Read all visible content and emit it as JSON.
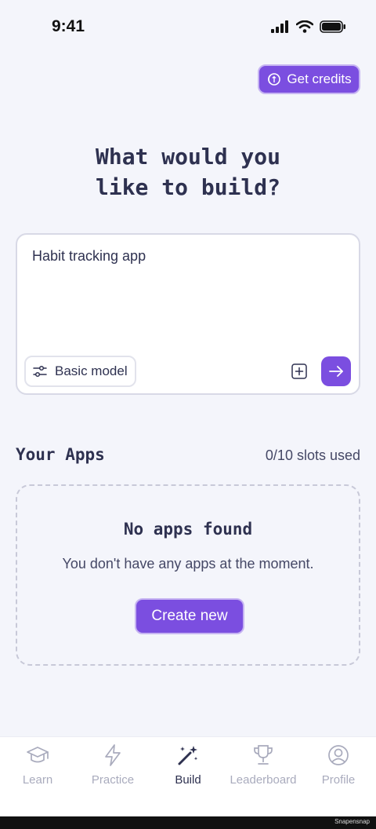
{
  "status_bar": {
    "time": "9:41"
  },
  "header": {
    "credits_label": "Get credits"
  },
  "headline": {
    "line1": "What would you",
    "line2": "like to build?"
  },
  "prompt": {
    "value": "Habit tracking app",
    "model_label": "Basic model"
  },
  "apps": {
    "title": "Your Apps",
    "slots": "0/10 slots used",
    "empty_title": "No apps found",
    "empty_desc": "You don't have any apps at the moment.",
    "create_label": "Create new"
  },
  "tabs": [
    {
      "label": "Learn",
      "icon": "graduation-cap-icon",
      "active": false
    },
    {
      "label": "Practice",
      "icon": "lightning-icon",
      "active": false
    },
    {
      "label": "Build",
      "icon": "magic-wand-icon",
      "active": true
    },
    {
      "label": "Leaderboard",
      "icon": "trophy-icon",
      "active": false
    },
    {
      "label": "Profile",
      "icon": "user-circle-icon",
      "active": false
    }
  ],
  "footer": {
    "watermark": "Snapensnap"
  },
  "colors": {
    "accent": "#7b4ee0",
    "background": "#f4f5fb",
    "text": "#2e3150"
  }
}
